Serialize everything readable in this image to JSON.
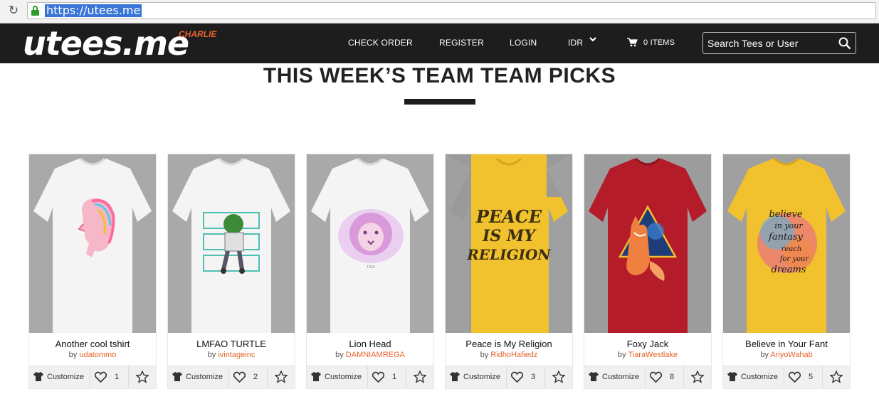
{
  "browser": {
    "url": "https://utees.me"
  },
  "header": {
    "logo": "utees.me",
    "logo_badge": "CHARLIE",
    "nav": {
      "check_order": "CHECK ORDER",
      "register": "REGISTER",
      "login": "LOGIN",
      "currency": "IDR",
      "cart": "0 ITEMS"
    },
    "search_placeholder": "Search Tees or User"
  },
  "section": {
    "title": "THIS WEEK’S TEAM TEAM PICKS"
  },
  "products": [
    {
      "name": "Another cool tshirt",
      "by": "by",
      "author": "udatommo",
      "customize": "Customize",
      "likes": "1",
      "shirt_color": "#f4f4f4",
      "design": "woman-portrait-icon"
    },
    {
      "name": "LMFAO TURTLE",
      "by": "by",
      "author": "ivintageinc",
      "customize": "Customize",
      "likes": "2",
      "shirt_color": "#f4f4f4",
      "design": "turtle-print-icon"
    },
    {
      "name": "Lion Head",
      "by": "by",
      "author": "DAMNIAMREGA",
      "customize": "Customize",
      "likes": "1",
      "shirt_color": "#f4f4f4",
      "design": "lion-head-icon"
    },
    {
      "name": "Peace is My Religion",
      "by": "by",
      "author": "RidhoHafiedz",
      "customize": "Customize",
      "likes": "3",
      "shirt_color": "#f2c12e",
      "design": "peace-text-icon"
    },
    {
      "name": "Foxy Jack",
      "by": "by",
      "author": "TiaraWestlake",
      "customize": "Customize",
      "likes": "8",
      "shirt_color": "#b51c2a",
      "design": "fox-triangle-icon"
    },
    {
      "name": "Believe in Your Fant",
      "by": "by",
      "author": "AriyoWahab",
      "customize": "Customize",
      "likes": "5",
      "shirt_color": "#f2c12e",
      "design": "believe-text-icon"
    }
  ],
  "colors": {
    "header_bg": "#1d1d1d",
    "accent": "#e8622a",
    "card_bg": "#f0f0f0"
  }
}
